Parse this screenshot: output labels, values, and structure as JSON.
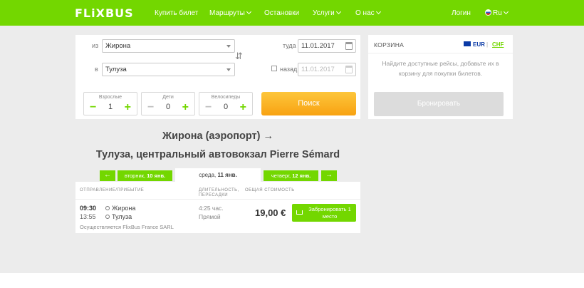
{
  "header": {
    "logo": "FLiXBUS",
    "nav": {
      "buy": "Купить билет",
      "routes": "Маршруты",
      "stations": "Остановки",
      "services": "Услуги",
      "about": "О нас",
      "login": "Логин",
      "lang": "Ru"
    }
  },
  "search": {
    "from_label": "из",
    "from_value": "Жирона",
    "to_label": "в",
    "to_value": "Тулуза",
    "depart_label": "туда",
    "depart_date": "11.01.2017",
    "return_label": "назад",
    "return_date": "11.01.2017",
    "return_checked": false,
    "passengers": [
      {
        "label": "Взрослые",
        "value": "1",
        "minus": "−",
        "plus": "+"
      },
      {
        "label": "Дети",
        "value": "0",
        "minus": "−",
        "plus": "+"
      },
      {
        "label": "Велосипеды",
        "value": "0",
        "minus": "−",
        "plus": "+"
      }
    ],
    "search_button": "Поиск"
  },
  "cart": {
    "title": "КОРЗИНА",
    "currency_eur": "EUR",
    "currency_sep": "|",
    "currency_chf": "CHF",
    "empty_text": "Найдите доступные рейсы, добавьте их в корзину для покупки билетов.",
    "book_button": "Бронировать"
  },
  "route": {
    "from_line": "Жирона (аэропорт) →",
    "to_line": "Тулуза, центральный автовокзал Pierre Sémard"
  },
  "days": {
    "prev_arrow": "←",
    "prev_day": "вторник,",
    "prev_date": "10 янв.",
    "current_day": "среда,",
    "current_date": "11 янв.",
    "next_day": "четверг,",
    "next_date": "12 янв.",
    "next_arrow": "→"
  },
  "results": {
    "col_departure": "ОТПРАВЛЕНИЕ/ПРИБЫТИЕ",
    "col_duration": "ДЛИТЕЛЬНОСТЬ, ПЕРЕСАДКИ",
    "col_price": "ОБЩАЯ СТОИМОСТЬ",
    "trips": [
      {
        "dep_time": "09:30",
        "arr_time": "13:55",
        "dep_station": "Жирона",
        "arr_station": "Тулуза",
        "duration": "4:25 час.",
        "transfers": "Прямой",
        "price": "19,00 €",
        "book_label": "Забронировать 1 место",
        "operator": "Осуществляется FlixBus France SARL"
      }
    ]
  },
  "colors": {
    "brand_green": "#73d700",
    "search_orange": "#f8a212"
  }
}
